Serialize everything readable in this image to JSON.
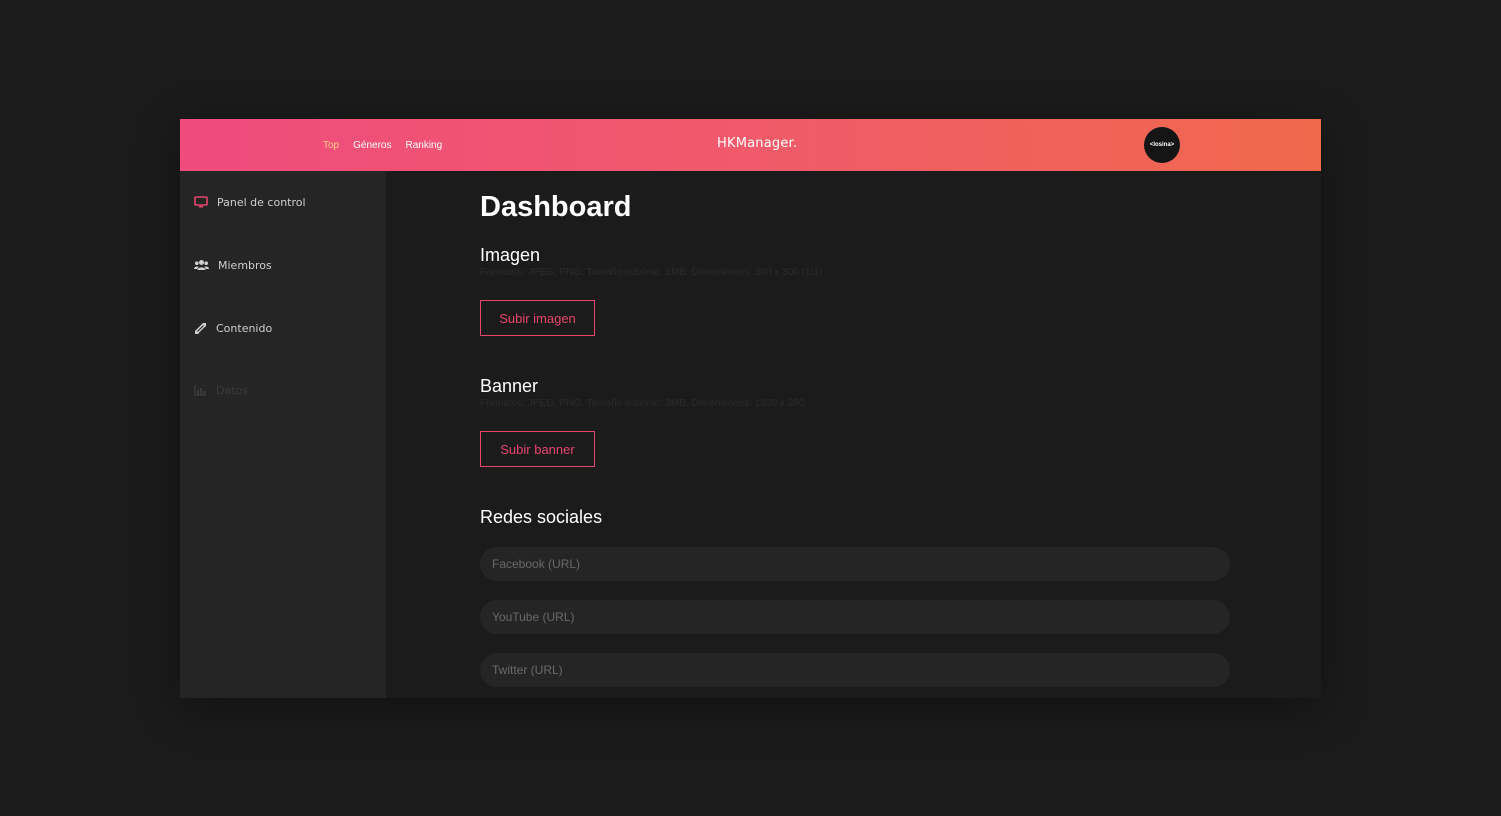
{
  "header": {
    "nav": [
      {
        "label": "Top",
        "active": true
      },
      {
        "label": "Géneros",
        "active": false
      },
      {
        "label": "Ranking",
        "active": false
      }
    ],
    "brand": "HKManager.",
    "avatar_text": "<losina>"
  },
  "sidebar": {
    "items": [
      {
        "label": "Panel de control",
        "icon": "monitor-icon"
      },
      {
        "label": "Miembros",
        "icon": "users-icon"
      },
      {
        "label": "Contenido",
        "icon": "layers-icon"
      },
      {
        "label": "Datos",
        "icon": "chart-icon",
        "disabled": true
      }
    ]
  },
  "main": {
    "title": "Dashboard",
    "image_section": {
      "title": "Imagen",
      "hint": "Formatos: JPEG, PNG. Tamaño máximo: 1MB. Dimensiones: 300 x 300 (1/1)",
      "button": "Subir imagen"
    },
    "banner_section": {
      "title": "Banner",
      "hint": "Formatos: JPEG, PNG. Tamaño máximo: 3MB. Dimensiones: 1920 x 280",
      "button": "Subir banner"
    },
    "social_section": {
      "title": "Redes sociales",
      "facebook_placeholder": "Facebook (URL)",
      "youtube_placeholder": "YouTube (URL)",
      "twitter_placeholder": "Twitter (URL)"
    }
  },
  "colors": {
    "gradient_start": "#ef4b7d",
    "gradient_end": "#f0694c",
    "accent": "#e8456d",
    "active_nav": "#ffd08a",
    "background": "#1c1b1c",
    "sidebar": "#262526"
  }
}
